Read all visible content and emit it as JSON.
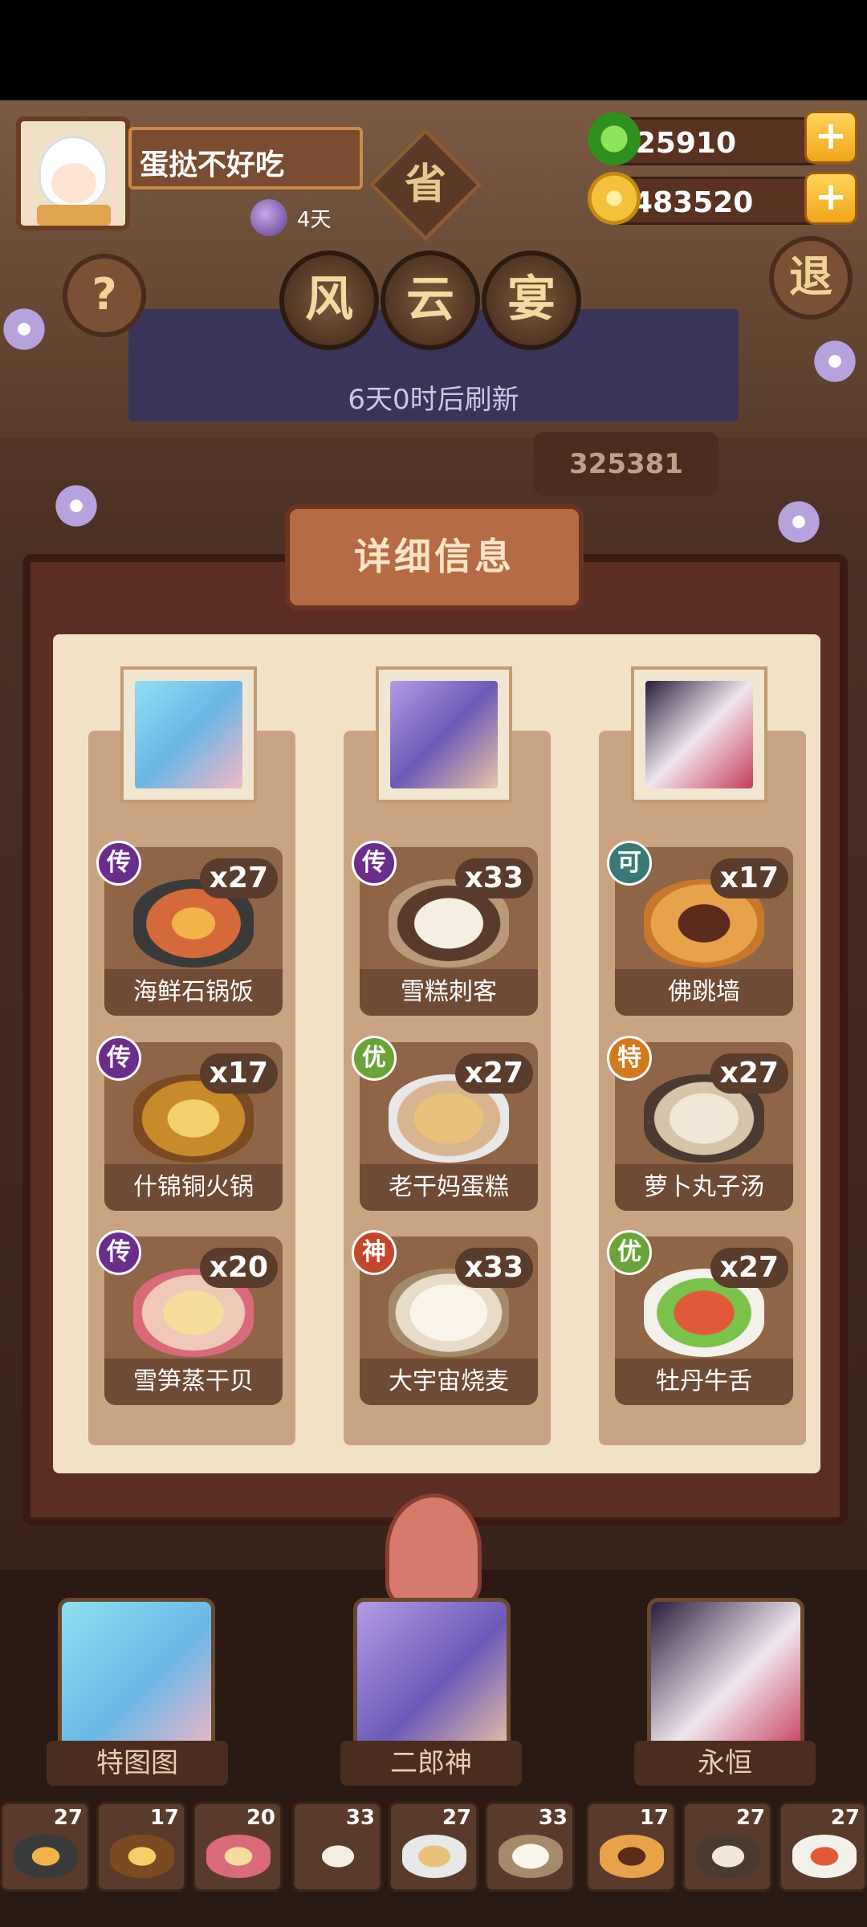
{
  "player": {
    "name": "蛋挞不好吃",
    "days": "4天"
  },
  "resources": {
    "jade": "25910",
    "coins": "5483520"
  },
  "buttons": {
    "help": "?",
    "exit": "退"
  },
  "event": {
    "province_badge": "省",
    "title_chars": [
      "风",
      "云",
      "宴"
    ],
    "refresh_text": "6天0时后刷新",
    "score_fragment": "325381"
  },
  "panel": {
    "title": "详细信息"
  },
  "columns": [
    {
      "dishes": [
        {
          "grade": "传",
          "count": "x27",
          "name": "海鲜石锅饭"
        },
        {
          "grade": "传",
          "count": "x17",
          "name": "什锦铜火锅"
        },
        {
          "grade": "传",
          "count": "x20",
          "name": "雪笋蒸干贝"
        }
      ]
    },
    {
      "dishes": [
        {
          "grade": "传",
          "count": "x33",
          "name": "雪糕刺客"
        },
        {
          "grade": "优",
          "count": "x27",
          "name": "老干妈蛋糕"
        },
        {
          "grade": "神",
          "count": "x33",
          "name": "大宇宙烧麦"
        }
      ]
    },
    {
      "dishes": [
        {
          "grade": "可",
          "count": "x17",
          "name": "佛跳墙"
        },
        {
          "grade": "特",
          "count": "x27",
          "name": "萝卜丸子汤"
        },
        {
          "grade": "优",
          "count": "x27",
          "name": "牡丹牛舌"
        }
      ]
    }
  ],
  "characters": [
    {
      "name": "特图图"
    },
    {
      "name": "二郎神"
    },
    {
      "name": "永恒"
    }
  ],
  "inventory": [
    {
      "count": "27"
    },
    {
      "count": "17"
    },
    {
      "count": "20"
    },
    {
      "count": "33"
    },
    {
      "count": "27"
    },
    {
      "count": "33"
    },
    {
      "count": "17"
    },
    {
      "count": "27"
    },
    {
      "count": "27"
    }
  ],
  "colors": {
    "grade_chuan": "#6a2d8a",
    "grade_you": "#6aa33a",
    "grade_shen": "#c4472c",
    "grade_ke": "#3a7a76",
    "grade_te": "#d47a1e"
  }
}
